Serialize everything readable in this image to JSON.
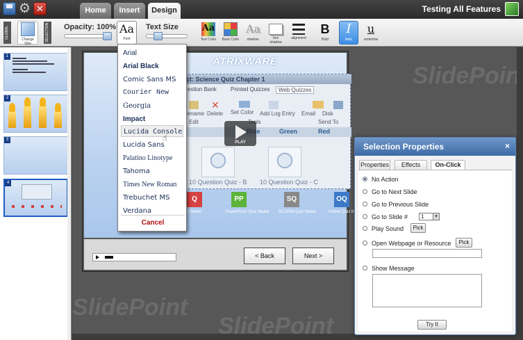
{
  "topbar": {
    "tabs": [
      {
        "label": "Home"
      },
      {
        "label": "Insert"
      },
      {
        "label": "Design"
      }
    ],
    "app_title": "Testing All Features"
  },
  "ribbon": {
    "global_tag": "GLOBAL",
    "selection_tag": "SELECTION",
    "change_skin": "Change Skin",
    "opacity_label": "Opacity: 100%",
    "opacity_value": 100,
    "font_glyph": "Aa",
    "font_label": "Font",
    "text_size_label": "Text Size",
    "text_color_glyph": "Aa",
    "text_color_label": "Text Color",
    "back_color_label": "Back Color",
    "shadow_glyph": "Aa",
    "shadow_label": "shadow",
    "box_shadow_label": "box shadow",
    "alignment_label": "alignment",
    "bold_glyph": "B",
    "bold_label": "Bold",
    "italic_glyph": "I",
    "italic_label": "Italic",
    "underline_glyph": "u",
    "underline_label": "underline",
    "colors": {
      "accent": "#3c8ee6",
      "dialog_header": "#3d6aa6",
      "cancel": "#b40f0f"
    }
  },
  "thumbnails": [
    {
      "number": "1"
    },
    {
      "number": "2"
    },
    {
      "number": "3"
    },
    {
      "number": "4"
    }
  ],
  "slide": {
    "logo": "ATRIXWARE",
    "quiz_window_title": "ct: Science Quiz Chapter 1",
    "quiz_tabs": [
      "estion Bank",
      "Printed Quizzes",
      "Web Quizzes"
    ],
    "quiz_tools": [
      "Rename",
      "Delete",
      "Set Color",
      "Add Log Entry",
      "Email",
      "Disk"
    ],
    "quiz_tool_groups": [
      "Edit",
      "Tools",
      "Send To"
    ],
    "color_options": [
      "Blue",
      "Green",
      "Red"
    ],
    "quiz_captions": [
      "10 Question Quiz - B",
      "10 Question Quiz - C"
    ],
    "play_label": "PLAY",
    "quiz_makers": [
      {
        "abbr": "Q",
        "title": "z Maker",
        "color": "#d64242"
      },
      {
        "abbr": "PP",
        "title": "PowerPoint Quiz Maker",
        "color": "#5cb33a"
      },
      {
        "abbr": "SQ",
        "title": "SCORM Quiz Maker",
        "color": "#888888"
      },
      {
        "abbr": "OQ",
        "title": "Online Quiz Ma",
        "color": "#3d79c9"
      }
    ],
    "back_label": "< Back",
    "next_label": "Next >"
  },
  "font_menu": {
    "items": [
      {
        "name": "Arial"
      },
      {
        "name": "Arial Black"
      },
      {
        "name": "Comic Sans MS"
      },
      {
        "name": "Courier New"
      },
      {
        "name": "Georgia"
      },
      {
        "name": "Impact"
      },
      {
        "name": "Lucida Console"
      },
      {
        "name": "Lucida Sans"
      },
      {
        "name": "Palatino Linotype"
      },
      {
        "name": "Tahoma"
      },
      {
        "name": "Times New Roman"
      },
      {
        "name": "Trebuchet MS"
      },
      {
        "name": "Verdana"
      }
    ],
    "highlighted": "Lucida Console",
    "cancel_label": "Cancel"
  },
  "dialog": {
    "title": "Selection Properties",
    "close_glyph": "×",
    "tabs": [
      "Properties",
      "Effects",
      "On-Click"
    ],
    "active_tab": "On-Click",
    "options": [
      {
        "label": "No Action",
        "selected": true
      },
      {
        "label": "Go to Next Slide",
        "selected": false
      },
      {
        "label": "Go to Previous Slide",
        "selected": false
      },
      {
        "label": "Go to Slide #",
        "selected": false
      },
      {
        "label": "Play Sound",
        "selected": false
      },
      {
        "label": "Open Webpage or Resource",
        "selected": false
      },
      {
        "label": "Show Message",
        "selected": false
      }
    ],
    "slide_number": "1",
    "pick_label": "Pick",
    "try_it_label": "Try It"
  },
  "watermark": "SlidePoint"
}
